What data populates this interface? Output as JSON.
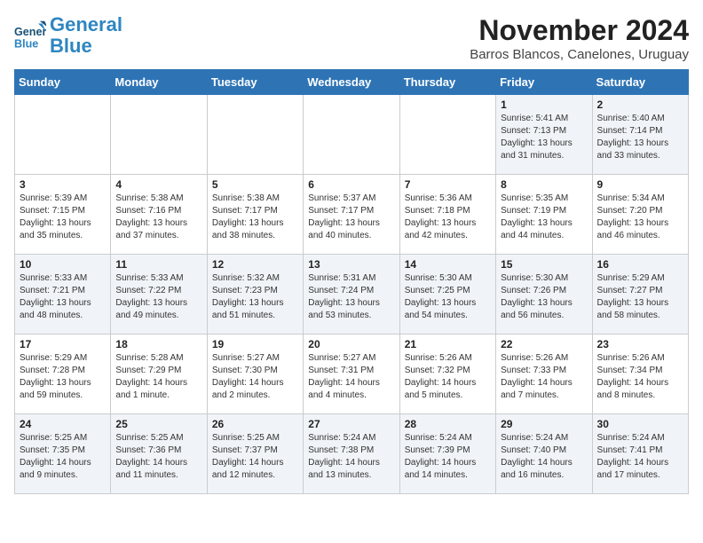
{
  "header": {
    "logo_line1": "General",
    "logo_line2": "Blue",
    "month_title": "November 2024",
    "subtitle": "Barros Blancos, Canelones, Uruguay"
  },
  "weekdays": [
    "Sunday",
    "Monday",
    "Tuesday",
    "Wednesday",
    "Thursday",
    "Friday",
    "Saturday"
  ],
  "weeks": [
    [
      {
        "day": "",
        "info": ""
      },
      {
        "day": "",
        "info": ""
      },
      {
        "day": "",
        "info": ""
      },
      {
        "day": "",
        "info": ""
      },
      {
        "day": "",
        "info": ""
      },
      {
        "day": "1",
        "info": "Sunrise: 5:41 AM\nSunset: 7:13 PM\nDaylight: 13 hours and 31 minutes."
      },
      {
        "day": "2",
        "info": "Sunrise: 5:40 AM\nSunset: 7:14 PM\nDaylight: 13 hours and 33 minutes."
      }
    ],
    [
      {
        "day": "3",
        "info": "Sunrise: 5:39 AM\nSunset: 7:15 PM\nDaylight: 13 hours and 35 minutes."
      },
      {
        "day": "4",
        "info": "Sunrise: 5:38 AM\nSunset: 7:16 PM\nDaylight: 13 hours and 37 minutes."
      },
      {
        "day": "5",
        "info": "Sunrise: 5:38 AM\nSunset: 7:17 PM\nDaylight: 13 hours and 38 minutes."
      },
      {
        "day": "6",
        "info": "Sunrise: 5:37 AM\nSunset: 7:17 PM\nDaylight: 13 hours and 40 minutes."
      },
      {
        "day": "7",
        "info": "Sunrise: 5:36 AM\nSunset: 7:18 PM\nDaylight: 13 hours and 42 minutes."
      },
      {
        "day": "8",
        "info": "Sunrise: 5:35 AM\nSunset: 7:19 PM\nDaylight: 13 hours and 44 minutes."
      },
      {
        "day": "9",
        "info": "Sunrise: 5:34 AM\nSunset: 7:20 PM\nDaylight: 13 hours and 46 minutes."
      }
    ],
    [
      {
        "day": "10",
        "info": "Sunrise: 5:33 AM\nSunset: 7:21 PM\nDaylight: 13 hours and 48 minutes."
      },
      {
        "day": "11",
        "info": "Sunrise: 5:33 AM\nSunset: 7:22 PM\nDaylight: 13 hours and 49 minutes."
      },
      {
        "day": "12",
        "info": "Sunrise: 5:32 AM\nSunset: 7:23 PM\nDaylight: 13 hours and 51 minutes."
      },
      {
        "day": "13",
        "info": "Sunrise: 5:31 AM\nSunset: 7:24 PM\nDaylight: 13 hours and 53 minutes."
      },
      {
        "day": "14",
        "info": "Sunrise: 5:30 AM\nSunset: 7:25 PM\nDaylight: 13 hours and 54 minutes."
      },
      {
        "day": "15",
        "info": "Sunrise: 5:30 AM\nSunset: 7:26 PM\nDaylight: 13 hours and 56 minutes."
      },
      {
        "day": "16",
        "info": "Sunrise: 5:29 AM\nSunset: 7:27 PM\nDaylight: 13 hours and 58 minutes."
      }
    ],
    [
      {
        "day": "17",
        "info": "Sunrise: 5:29 AM\nSunset: 7:28 PM\nDaylight: 13 hours and 59 minutes."
      },
      {
        "day": "18",
        "info": "Sunrise: 5:28 AM\nSunset: 7:29 PM\nDaylight: 14 hours and 1 minute."
      },
      {
        "day": "19",
        "info": "Sunrise: 5:27 AM\nSunset: 7:30 PM\nDaylight: 14 hours and 2 minutes."
      },
      {
        "day": "20",
        "info": "Sunrise: 5:27 AM\nSunset: 7:31 PM\nDaylight: 14 hours and 4 minutes."
      },
      {
        "day": "21",
        "info": "Sunrise: 5:26 AM\nSunset: 7:32 PM\nDaylight: 14 hours and 5 minutes."
      },
      {
        "day": "22",
        "info": "Sunrise: 5:26 AM\nSunset: 7:33 PM\nDaylight: 14 hours and 7 minutes."
      },
      {
        "day": "23",
        "info": "Sunrise: 5:26 AM\nSunset: 7:34 PM\nDaylight: 14 hours and 8 minutes."
      }
    ],
    [
      {
        "day": "24",
        "info": "Sunrise: 5:25 AM\nSunset: 7:35 PM\nDaylight: 14 hours and 9 minutes."
      },
      {
        "day": "25",
        "info": "Sunrise: 5:25 AM\nSunset: 7:36 PM\nDaylight: 14 hours and 11 minutes."
      },
      {
        "day": "26",
        "info": "Sunrise: 5:25 AM\nSunset: 7:37 PM\nDaylight: 14 hours and 12 minutes."
      },
      {
        "day": "27",
        "info": "Sunrise: 5:24 AM\nSunset: 7:38 PM\nDaylight: 14 hours and 13 minutes."
      },
      {
        "day": "28",
        "info": "Sunrise: 5:24 AM\nSunset: 7:39 PM\nDaylight: 14 hours and 14 minutes."
      },
      {
        "day": "29",
        "info": "Sunrise: 5:24 AM\nSunset: 7:40 PM\nDaylight: 14 hours and 16 minutes."
      },
      {
        "day": "30",
        "info": "Sunrise: 5:24 AM\nSunset: 7:41 PM\nDaylight: 14 hours and 17 minutes."
      }
    ]
  ]
}
